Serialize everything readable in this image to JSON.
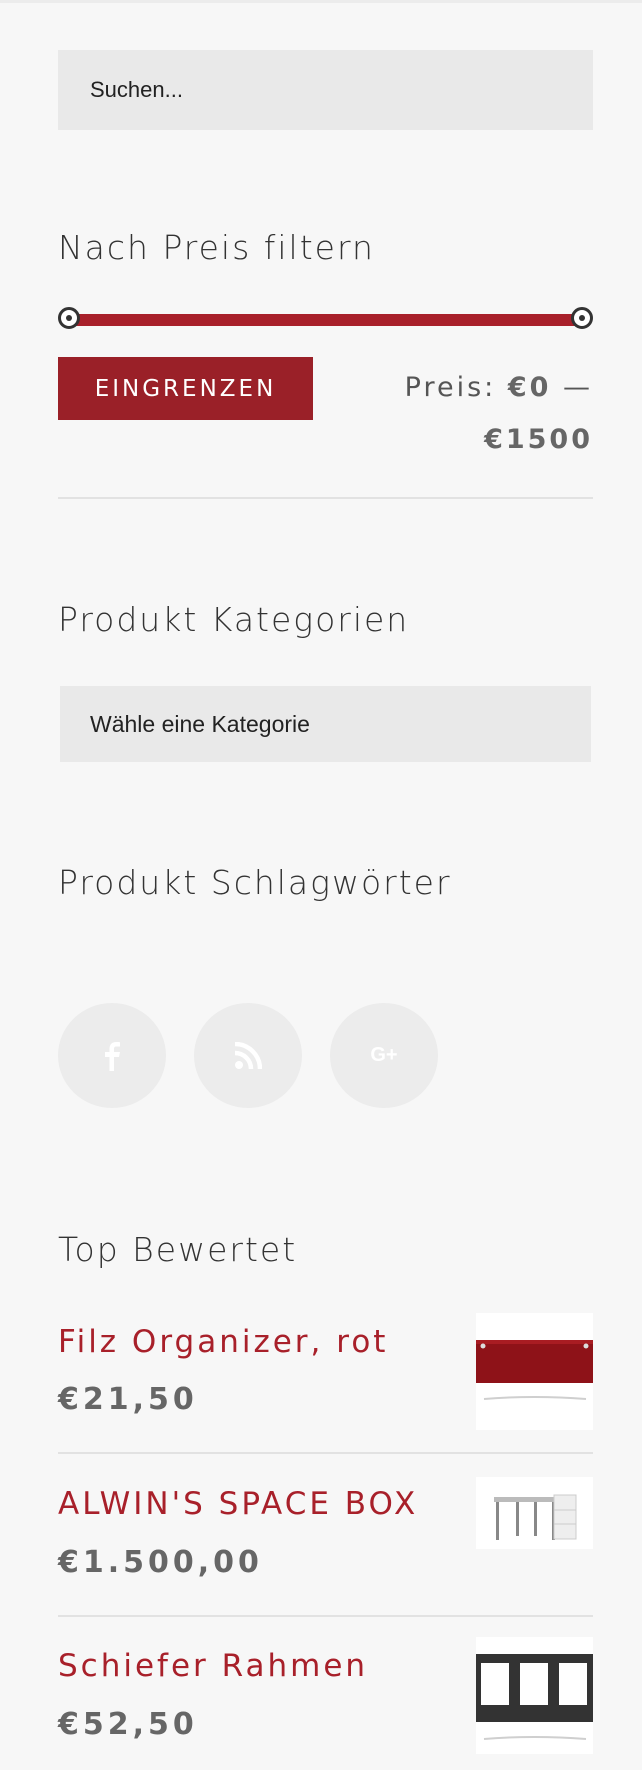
{
  "search": {
    "placeholder": "Suchen..."
  },
  "price_filter": {
    "title": "Nach Preis filtern",
    "button_label": "EINGRENZEN",
    "price_prefix": "Preis:",
    "min_label": "€0",
    "separator": "—",
    "max_label": "€1500",
    "range_min": 0,
    "range_max": 1500,
    "selected_min": 0,
    "selected_max": 1500,
    "accent_color": "#a8202a"
  },
  "categories": {
    "title": "Produkt Kategorien",
    "select_value": "Wähle eine Kategorie"
  },
  "tags": {
    "title": "Produkt Schlagwörter"
  },
  "social": {
    "icons": [
      "facebook-icon",
      "rss-icon",
      "google-plus-icon"
    ],
    "glyphs": [
      "f",
      "",
      "G+"
    ]
  },
  "top_rated": {
    "title": "Top Bewertet",
    "products": [
      {
        "name": "Filz Organizer, rot",
        "price": "€21,50",
        "thumb": "red-felt-organizer"
      },
      {
        "name": "ALWIN'S SPACE BOX",
        "price": "€1.500,00",
        "thumb": "space-box-table"
      },
      {
        "name": "Schiefer Rahmen",
        "price": "€52,50",
        "thumb": "slate-frame"
      }
    ]
  }
}
